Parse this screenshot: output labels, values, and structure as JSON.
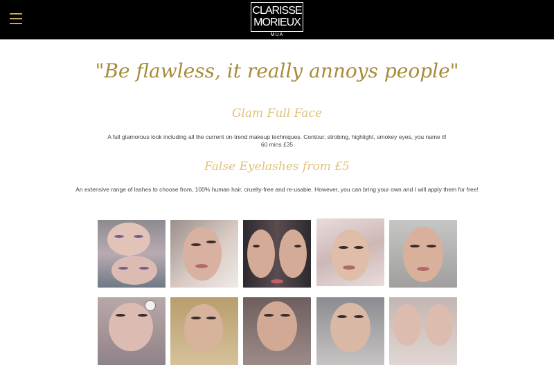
{
  "header": {
    "menu_icon": "hamburger-icon",
    "logo": {
      "line1": "CLARISSE",
      "line2": "MORIEUX",
      "sub": "MUA"
    }
  },
  "main": {
    "tagline": "\"Be flawless, it really annoys people\"",
    "services": [
      {
        "title": "Glam Full Face",
        "description": "A full glamorous look including all the current on-trend makeup techniques. Contour, strobing, highlight, smokey eyes, you name it!",
        "detail": "60 mins £35"
      },
      {
        "title": "False Eyelashes from £5",
        "description": "An extensive range of lashes to choose from, 100% human hair, cruelty-free and re-usable. However, you can bring your own and I will apply them for free!"
      }
    ]
  },
  "colors": {
    "header_bg": "#000000",
    "gold": "#c9a94e",
    "tagline": "#a88b3a",
    "section_title": "#e0c27a",
    "text": "#444444"
  }
}
